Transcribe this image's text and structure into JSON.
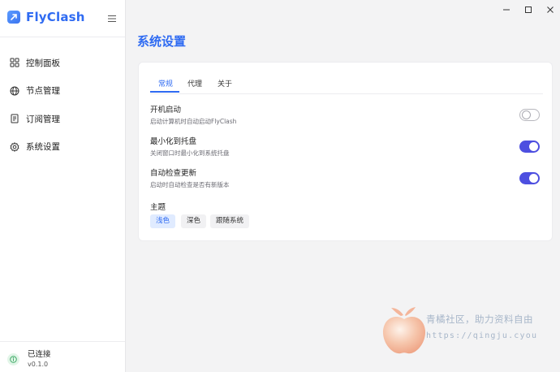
{
  "app": {
    "name": "FlyClash"
  },
  "sidebar": {
    "items": [
      {
        "label": "控制面板",
        "icon": "grid-icon"
      },
      {
        "label": "节点管理",
        "icon": "globe-icon"
      },
      {
        "label": "订阅管理",
        "icon": "document-icon"
      },
      {
        "label": "系统设置",
        "icon": "gear-icon"
      }
    ],
    "status": {
      "label": "已连接",
      "version": "v0.1.0",
      "color": "#2ea35a"
    }
  },
  "page": {
    "title": "系统设置"
  },
  "tabs": [
    {
      "label": "常规",
      "active": true
    },
    {
      "label": "代理",
      "active": false
    },
    {
      "label": "关于",
      "active": false
    }
  ],
  "settings": [
    {
      "title": "开机启动",
      "desc": "启动计算机时自动启动FlyClash",
      "enabled": false
    },
    {
      "title": "最小化到托盘",
      "desc": "关闭窗口时最小化到系统托盘",
      "enabled": true
    },
    {
      "title": "自动检查更新",
      "desc": "启动时自动检查是否有新版本",
      "enabled": true
    }
  ],
  "theme": {
    "label": "主题",
    "options": [
      {
        "label": "浅色",
        "selected": true
      },
      {
        "label": "深色",
        "selected": false
      },
      {
        "label": "跟随系统",
        "selected": false
      }
    ]
  },
  "watermark": {
    "text": "青橘社区，助力资料自由",
    "url": "https://qingju.cyou"
  },
  "colors": {
    "accent": "#2f6bf2",
    "toggle_on": "#4d4fe0",
    "watermark": "#a7b6c9"
  }
}
